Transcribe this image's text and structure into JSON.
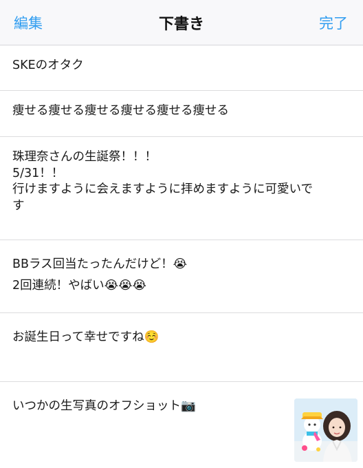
{
  "nav": {
    "edit_label": "編集",
    "title": "下書き",
    "done_label": "完了"
  },
  "drafts": [
    {
      "lines": [
        "SKEのオタク"
      ]
    },
    {
      "lines": [
        "痩せる痩せる痩せる痩せる痩せる痩せる"
      ]
    },
    {
      "lines": [
        "珠理奈さんの生誕祭！！！",
        "5/31！！",
        "行けますように会えますように拝めますように可愛いで",
        "す"
      ]
    },
    {
      "lines": [
        "BBラス回当たったんだけど！😭",
        "2回連続！やばい😭😭😭"
      ]
    },
    {
      "lines": [
        "お誕生日って幸せですね☺️"
      ]
    },
    {
      "lines": [
        "いつかの生写真のオフショット📷"
      ],
      "has_photo": true
    }
  ]
}
